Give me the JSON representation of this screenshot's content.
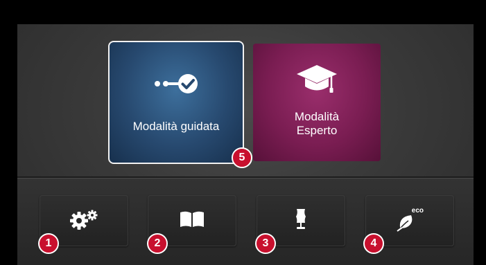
{
  "modes": {
    "guided": {
      "label": "Modalità guidata",
      "icon": "guided-check-icon",
      "color": "#27496f",
      "selected": true
    },
    "expert": {
      "label": "Modalità\nEsperto",
      "icon": "graduation-cap-icon",
      "color": "#7a1d52"
    }
  },
  "buttons": [
    {
      "icon": "gears-icon",
      "badge": "1"
    },
    {
      "icon": "book-icon",
      "badge": "2"
    },
    {
      "icon": "dress-form-icon",
      "badge": "3"
    },
    {
      "icon": "eco-leaf-icon",
      "badge": "4",
      "text": "eco"
    }
  ],
  "callout_5": "5",
  "colors": {
    "badge": "#c8102e",
    "background": "#3a3a3a",
    "text": "#ffffff"
  }
}
